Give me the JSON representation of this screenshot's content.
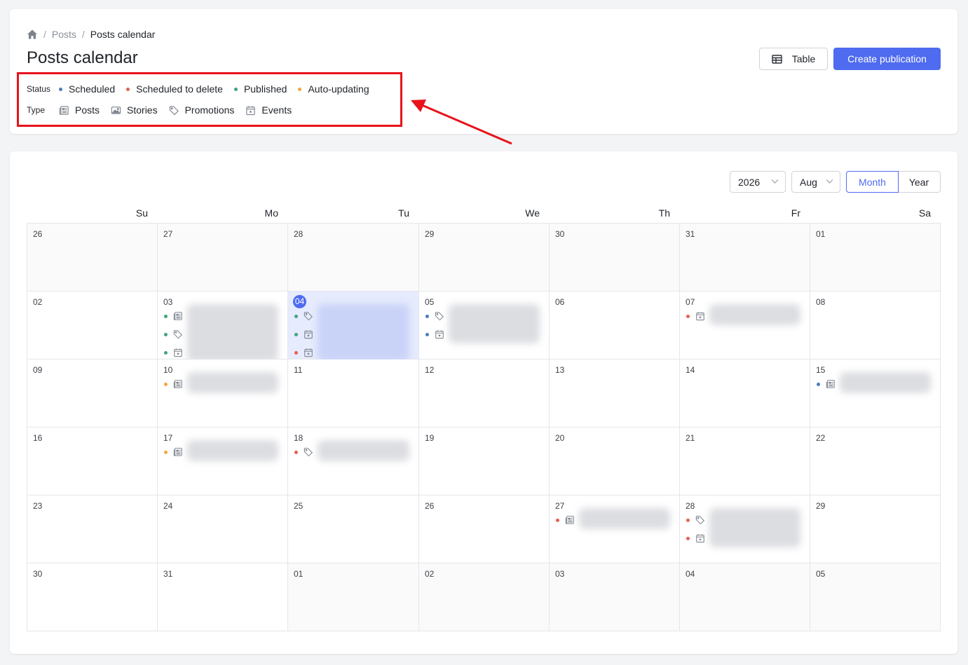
{
  "breadcrumb": {
    "home": "home-icon",
    "items": [
      "Posts",
      "Posts calendar"
    ]
  },
  "title": "Posts calendar",
  "legend": {
    "status_label": "Status",
    "statuses": [
      {
        "label": "Scheduled",
        "color": "#4a7cc2"
      },
      {
        "label": "Scheduled to delete",
        "color": "#e5604f"
      },
      {
        "label": "Published",
        "color": "#3ea67a"
      },
      {
        "label": "Auto-updating",
        "color": "#f4a53f"
      }
    ],
    "type_label": "Type",
    "types": [
      {
        "label": "Posts",
        "icon": "newspaper-icon"
      },
      {
        "label": "Stories",
        "icon": "image-icon"
      },
      {
        "label": "Promotions",
        "icon": "tag-icon"
      },
      {
        "label": "Events",
        "icon": "calendar-star-icon"
      }
    ]
  },
  "buttons": {
    "table": "Table",
    "create": "Create publication"
  },
  "calendar": {
    "year": "2026",
    "month": "Aug",
    "view_month": "Month",
    "view_year": "Year",
    "weekdays": [
      "Su",
      "Mo",
      "Tu",
      "We",
      "Th",
      "Fr",
      "Sa"
    ],
    "weeks": [
      [
        "26",
        "27",
        "28",
        "29",
        "30",
        "31",
        "01"
      ],
      [
        "02",
        "03",
        "04",
        "05",
        "06",
        "07",
        "08"
      ],
      [
        "09",
        "10",
        "11",
        "12",
        "13",
        "14",
        "15"
      ],
      [
        "16",
        "17",
        "18",
        "19",
        "20",
        "21",
        "22"
      ],
      [
        "23",
        "24",
        "25",
        "26",
        "27",
        "28",
        "29"
      ],
      [
        "30",
        "31",
        "01",
        "02",
        "03",
        "04",
        "05"
      ]
    ],
    "today": "04",
    "events": {
      "1-1": [
        [
          "published",
          "posts"
        ],
        [
          "published",
          "promotions"
        ],
        [
          "published",
          "events"
        ]
      ],
      "1-2": [
        [
          "published",
          "promotions"
        ],
        [
          "published",
          "events"
        ],
        [
          "delete",
          "events"
        ]
      ],
      "1-3": [
        [
          "scheduled",
          "promotions"
        ],
        [
          "scheduled",
          "events"
        ]
      ],
      "1-5": [
        [
          "delete",
          "events"
        ]
      ],
      "2-1": [
        [
          "auto",
          "posts"
        ]
      ],
      "2-6": [
        [
          "scheduled",
          "posts"
        ]
      ],
      "3-1": [
        [
          "auto",
          "posts"
        ]
      ],
      "3-2": [
        [
          "delete",
          "promotions"
        ]
      ],
      "4-4": [
        [
          "delete",
          "posts"
        ]
      ],
      "4-5": [
        [
          "delete",
          "promotions"
        ],
        [
          "delete",
          "events"
        ]
      ]
    }
  },
  "colors": {
    "scheduled": "#4a7cc2",
    "delete": "#e5604f",
    "published": "#3ea67a",
    "auto": "#f4a53f",
    "accent": "#4f6bf0",
    "highlight": "#e8131b"
  }
}
